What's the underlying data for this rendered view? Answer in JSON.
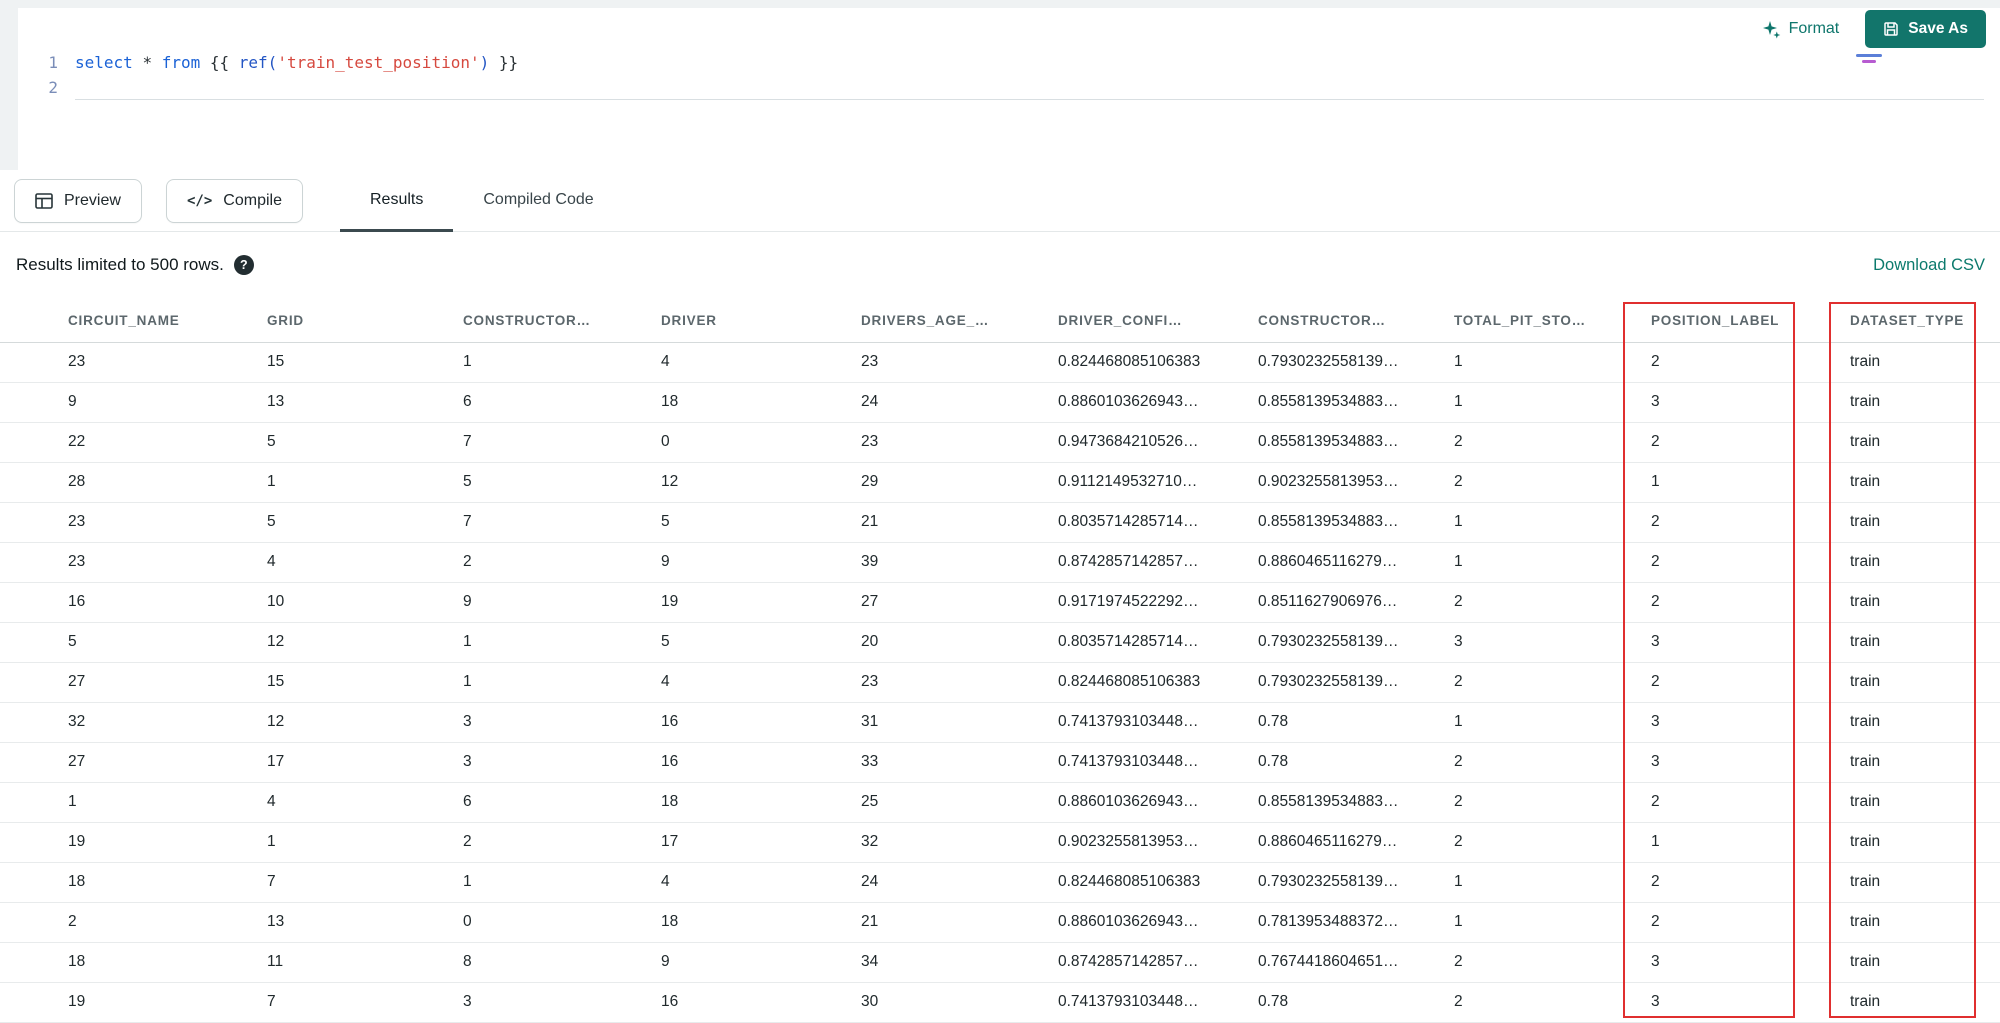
{
  "editor": {
    "toolbar": {
      "format_label": "Format",
      "save_as_label": "Save As"
    },
    "line_numbers": [
      "1",
      "2"
    ],
    "code_tokens": [
      {
        "text": "select ",
        "type": "keyword"
      },
      {
        "text": "* ",
        "type": "plain"
      },
      {
        "text": "from ",
        "type": "keyword"
      },
      {
        "text": "{{ ",
        "type": "plain"
      },
      {
        "text": "ref(",
        "type": "function"
      },
      {
        "text": "'train_test_position'",
        "type": "string"
      },
      {
        "text": ")",
        "type": "function"
      },
      {
        "text": " }}",
        "type": "plain"
      }
    ]
  },
  "panel": {
    "preview_label": "Preview",
    "compile_label": "Compile",
    "tabs": [
      {
        "label": "Results",
        "active": true
      },
      {
        "label": "Compiled Code",
        "active": false
      }
    ]
  },
  "results": {
    "limit_note": "Results limited to 500 rows.",
    "help_icon": "?",
    "download_label": "Download CSV"
  },
  "table": {
    "columns": [
      "CIRCUIT_NAME",
      "GRID",
      "CONSTRUCTOR…",
      "DRIVER",
      "DRIVERS_AGE_…",
      "DRIVER_CONFI…",
      "CONSTRUCTOR…",
      "TOTAL_PIT_STO…",
      "POSITION_LABEL",
      "DATASET_TYPE"
    ],
    "highlighted_columns": [
      "POSITION_LABEL",
      "DATASET_TYPE"
    ],
    "rows": [
      [
        "23",
        "15",
        "1",
        "4",
        "23",
        "0.824468085106383",
        "0.7930232558139…",
        "1",
        "2",
        "train"
      ],
      [
        "9",
        "13",
        "6",
        "18",
        "24",
        "0.8860103626943…",
        "0.8558139534883…",
        "1",
        "3",
        "train"
      ],
      [
        "22",
        "5",
        "7",
        "0",
        "23",
        "0.9473684210526…",
        "0.8558139534883…",
        "2",
        "2",
        "train"
      ],
      [
        "28",
        "1",
        "5",
        "12",
        "29",
        "0.9112149532710…",
        "0.9023255813953…",
        "2",
        "1",
        "train"
      ],
      [
        "23",
        "5",
        "7",
        "5",
        "21",
        "0.8035714285714…",
        "0.8558139534883…",
        "1",
        "2",
        "train"
      ],
      [
        "23",
        "4",
        "2",
        "9",
        "39",
        "0.8742857142857…",
        "0.8860465116279…",
        "1",
        "2",
        "train"
      ],
      [
        "16",
        "10",
        "9",
        "19",
        "27",
        "0.9171974522292…",
        "0.8511627906976…",
        "2",
        "2",
        "train"
      ],
      [
        "5",
        "12",
        "1",
        "5",
        "20",
        "0.8035714285714…",
        "0.7930232558139…",
        "3",
        "3",
        "train"
      ],
      [
        "27",
        "15",
        "1",
        "4",
        "23",
        "0.824468085106383",
        "0.7930232558139…",
        "2",
        "2",
        "train"
      ],
      [
        "32",
        "12",
        "3",
        "16",
        "31",
        "0.7413793103448…",
        "0.78",
        "1",
        "3",
        "train"
      ],
      [
        "27",
        "17",
        "3",
        "16",
        "33",
        "0.7413793103448…",
        "0.78",
        "2",
        "3",
        "train"
      ],
      [
        "1",
        "4",
        "6",
        "18",
        "25",
        "0.8860103626943…",
        "0.8558139534883…",
        "2",
        "2",
        "train"
      ],
      [
        "19",
        "1",
        "2",
        "17",
        "32",
        "0.9023255813953…",
        "0.8860465116279…",
        "2",
        "1",
        "train"
      ],
      [
        "18",
        "7",
        "1",
        "4",
        "24",
        "0.824468085106383",
        "0.7930232558139…",
        "1",
        "2",
        "train"
      ],
      [
        "2",
        "13",
        "0",
        "18",
        "21",
        "0.8860103626943…",
        "0.7813953488372…",
        "1",
        "2",
        "train"
      ],
      [
        "18",
        "11",
        "8",
        "9",
        "34",
        "0.8742857142857…",
        "0.7674418604651…",
        "2",
        "3",
        "train"
      ],
      [
        "19",
        "7",
        "3",
        "16",
        "30",
        "0.7413793103448…",
        "0.78",
        "2",
        "3",
        "train"
      ]
    ]
  },
  "colors": {
    "accent_teal": "#0e766c",
    "save_button_teal": "#12756b",
    "highlight_red": "#e02f2f"
  }
}
